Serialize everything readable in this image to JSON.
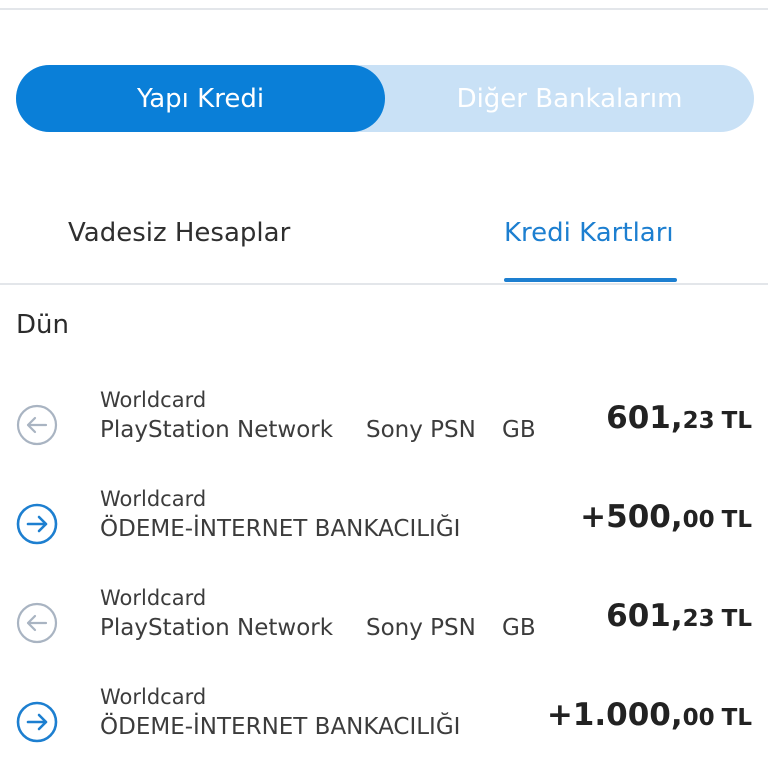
{
  "segment": {
    "active_label": "Yapı Kredi",
    "inactive_label": "Diğer Bankalarım"
  },
  "tabs": [
    {
      "label": "Vadesiz Hesaplar",
      "selected": false
    },
    {
      "label": "Kredi Kartları",
      "selected": true
    }
  ],
  "colors": {
    "accent": "#0a7fd8",
    "segment_bg": "#c9e1f6",
    "outgoing_icon": "#a9b4c2",
    "incoming_icon": "#1d7fd0"
  },
  "section": {
    "date_label": "Dün"
  },
  "transactions": [
    {
      "direction": "outgoing",
      "icon": "arrow-left-circle-icon",
      "card": "Worldcard",
      "description": "PlayStation Network",
      "merchant": "Sony PSN",
      "country": "GB",
      "amount_main": "601,",
      "amount_decimal": "23",
      "currency": "TL"
    },
    {
      "direction": "incoming",
      "icon": "arrow-right-circle-icon",
      "card": "Worldcard",
      "description": "ÖDEME-İNTERNET BANKACILIĞI",
      "merchant": "",
      "country": "",
      "amount_main": "+500,",
      "amount_decimal": "00",
      "currency": "TL"
    },
    {
      "direction": "outgoing",
      "icon": "arrow-left-circle-icon",
      "card": "Worldcard",
      "description": "PlayStation Network",
      "merchant": "Sony PSN",
      "country": "GB",
      "amount_main": "601,",
      "amount_decimal": "23",
      "currency": "TL"
    },
    {
      "direction": "incoming",
      "icon": "arrow-right-circle-icon",
      "card": "Worldcard",
      "description": "ÖDEME-İNTERNET BANKACILIĞI",
      "merchant": "",
      "country": "",
      "amount_main": "+1.000,",
      "amount_decimal": "00",
      "currency": "TL"
    }
  ]
}
